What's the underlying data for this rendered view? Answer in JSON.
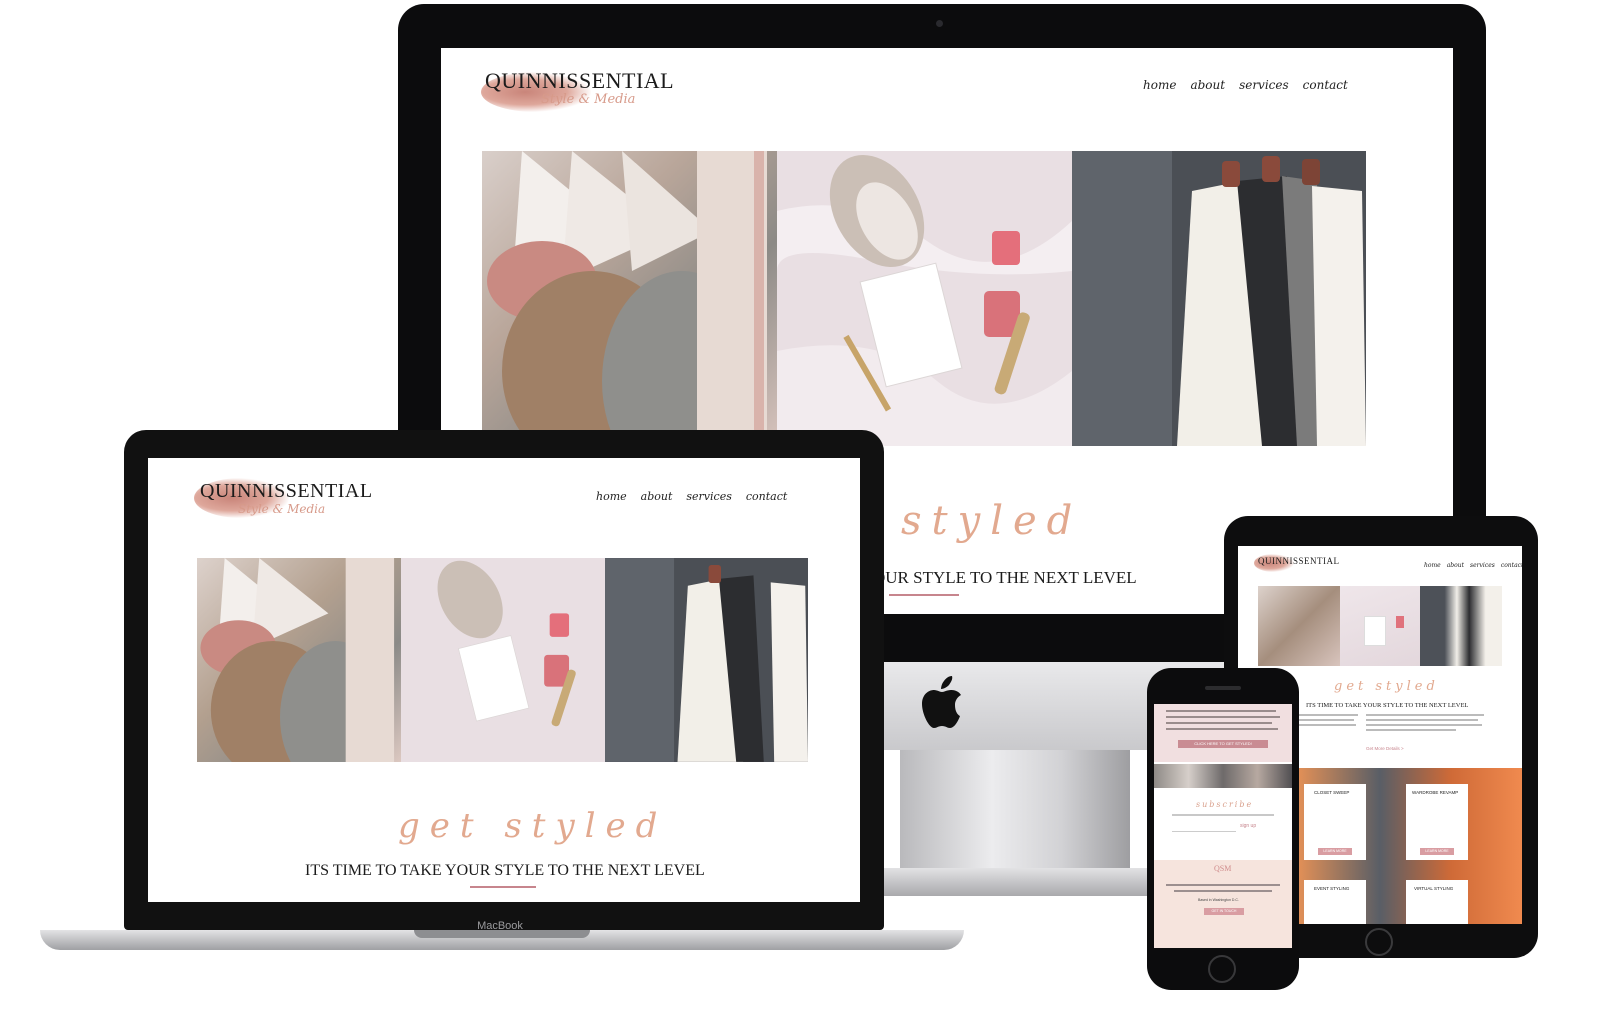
{
  "site": {
    "brand": "QUINNISSENTIAL",
    "tagline": "Style & Media",
    "nav": [
      "home",
      "about",
      "services",
      "contact"
    ],
    "script_heading": "get styled",
    "headline": "ITS TIME TO TAKE YOUR STYLE TO THE NEXT LEVEL",
    "headline_imac_cropped": "OUR STYLE TO THE NEXT LEVEL",
    "script_heading_imac_cropped": "styled"
  },
  "devices": {
    "laptop_label": "MacBook"
  },
  "tablet": {
    "services": [
      "CLOSET SWEEP",
      "WARDROBE REVAMP",
      "EVENT STYLING",
      "VIRTUAL STYLING"
    ],
    "service_button": "LEARN MORE",
    "read_more": "Get More Details >"
  },
  "phone": {
    "cta_button": "CLICK HERE TO GET STYLED!",
    "subscribe_heading": "subscribe",
    "signup_label": "sign up",
    "footer_brand": "QSM",
    "footer_location": "Based in Washington D.C.",
    "footer_button": "GET IN TOUCH"
  },
  "colors": {
    "accent": "#e2a98f",
    "rule": "#c7858d",
    "button": "#d99da2",
    "frame": "#0c0c0d"
  }
}
